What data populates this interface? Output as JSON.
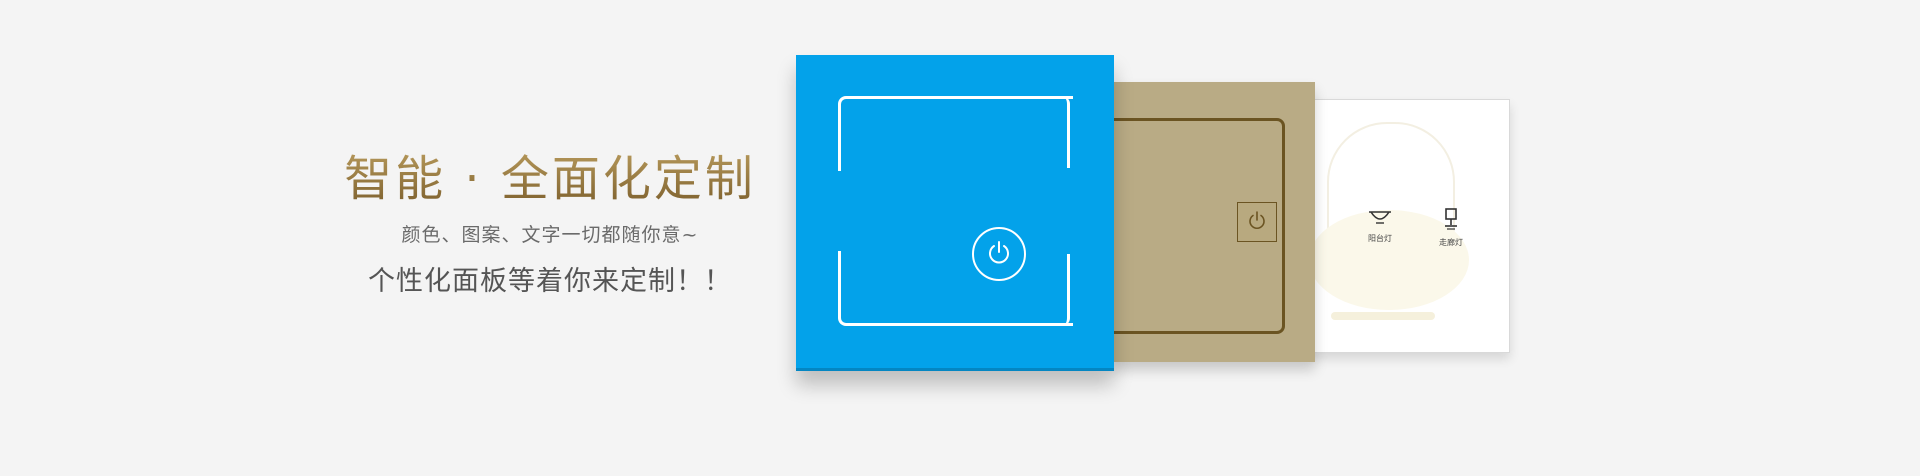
{
  "hero": {
    "headline": "智能 · 全面化定制",
    "subline": "颜色、图案、文字一切都随你意~",
    "tagline": "个性化面板等着你来定制！！"
  },
  "panels": {
    "white_panel": {
      "labels": [
        "阳台灯",
        "走廊灯"
      ],
      "icons": [
        "ceiling-lamp-icon",
        "desk-lamp-icon"
      ]
    },
    "gold_panel": {
      "icon": "power-icon"
    },
    "blue_panel": {
      "icon": "power-icon"
    }
  },
  "colors": {
    "background": "#f4f4f4",
    "blue_panel": "#03a2ea",
    "gold_panel": "#b9ab85",
    "gold_line": "#6b5422",
    "headline_gold": "#8e713c"
  }
}
